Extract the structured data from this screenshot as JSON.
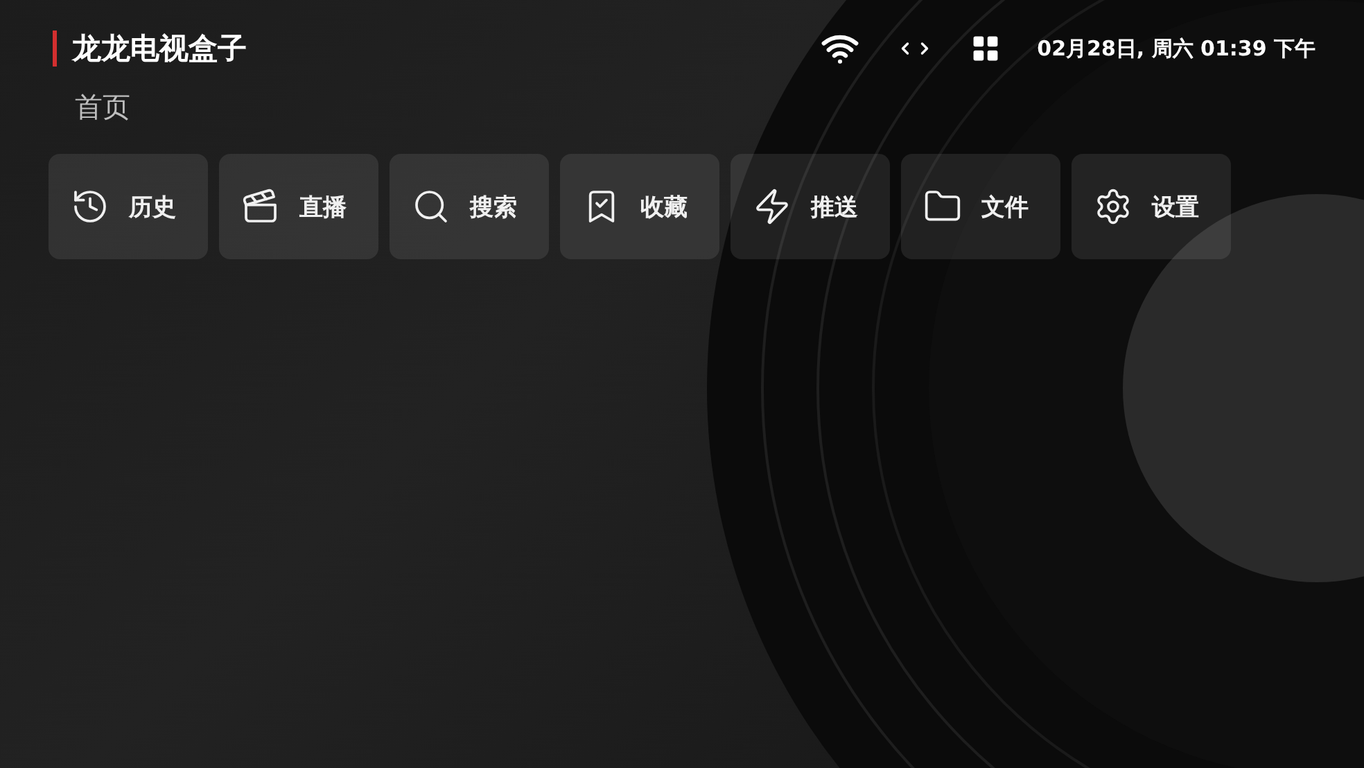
{
  "header": {
    "title": "龙龙电视盒子",
    "datetime": "02月28日, 周六 01:39 下午"
  },
  "page_title": "首页",
  "buttons": [
    {
      "label": "历史",
      "kind": "history"
    },
    {
      "label": "直播",
      "kind": "live"
    },
    {
      "label": "搜索",
      "kind": "search"
    },
    {
      "label": "收藏",
      "kind": "favorite"
    },
    {
      "label": "推送",
      "kind": "push"
    },
    {
      "label": "文件",
      "kind": "file"
    },
    {
      "label": "设置",
      "kind": "settings"
    }
  ]
}
